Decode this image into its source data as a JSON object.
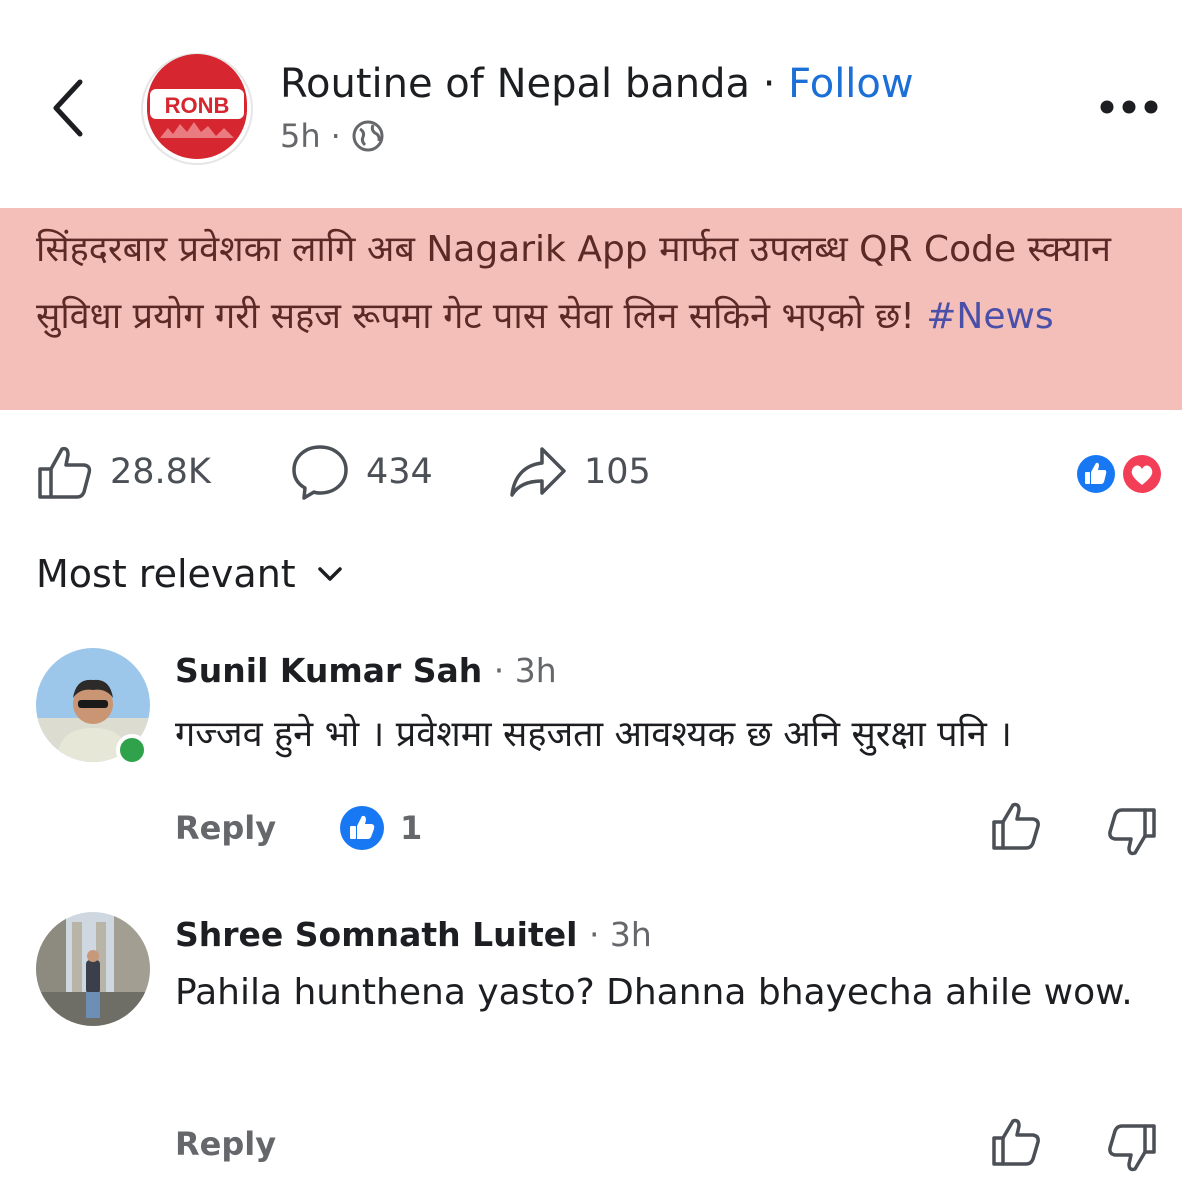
{
  "header": {
    "page_name": "Routine of Nepal banda",
    "separator": " · ",
    "follow_label": "Follow",
    "time": "5h",
    "dot": "·",
    "audience_icon": "globe-icon",
    "logo_text": "RONB",
    "logo_color": "#d6262f"
  },
  "post": {
    "text": "सिंहदरबार प्रवेशका लागि अब Nagarik App मार्फत उपलब्ध QR Code स्क्यान सुविधा प्रयोग गरी सहज रूपमा गेट पास सेवा लिन सकिने भएको छ!",
    "hashtag": "#News",
    "highlight_color": "#f5bfb9"
  },
  "stats": {
    "likes": "28.8K",
    "comments": "434",
    "shares": "105",
    "reaction_icons": [
      "like-reaction-icon",
      "love-reaction-icon"
    ]
  },
  "sort": {
    "label": "Most relevant"
  },
  "comments": [
    {
      "name": "Sunil Kumar Sah",
      "time": "· 3h",
      "text": "गज्जव हुने भो । प्रवेशमा सहजता आवश्यक छ अनि सुरक्षा पनि ।",
      "reply_label": "Reply",
      "like_count": "1",
      "online": true
    },
    {
      "name": "Shree Somnath Luitel",
      "time": "· 3h",
      "text": "Pahila hunthena yasto? Dhanna bhayecha ahile wow.",
      "reply_label": "Reply"
    }
  ]
}
